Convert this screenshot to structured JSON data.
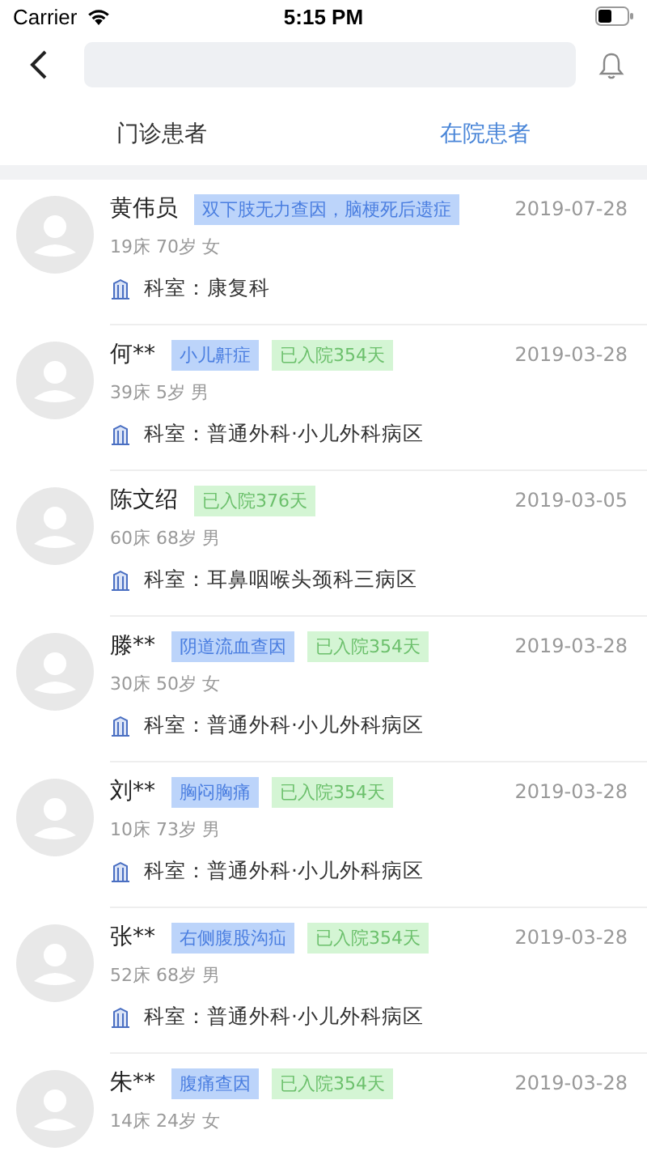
{
  "status_bar": {
    "carrier": "Carrier",
    "time": "5:15 PM"
  },
  "tabs": [
    {
      "label": "门诊患者",
      "selected": false
    },
    {
      "label": "在院患者",
      "selected": true
    }
  ],
  "patients": [
    {
      "name": "黄伟员",
      "diagnosis": "双下肢无力查因，脑梗死后遗症",
      "date": "2019-07-28",
      "info": "19床 70岁 女",
      "department": "科室：康复科"
    },
    {
      "name": "何**",
      "diagnosis": "小儿鼾症",
      "stay": "已入院354天",
      "date": "2019-03-28",
      "info": "39床 5岁 男",
      "department": "科室：普通外科·小儿外科病区"
    },
    {
      "name": "陈文绍",
      "stay": "已入院376天",
      "date": "2019-03-05",
      "info": "60床 68岁 男",
      "department": "科室：耳鼻咽喉头颈科三病区"
    },
    {
      "name": "滕**",
      "diagnosis": "阴道流血查因",
      "stay": "已入院354天",
      "date": "2019-03-28",
      "info": "30床 50岁 女",
      "department": "科室：普通外科·小儿外科病区"
    },
    {
      "name": "刘**",
      "diagnosis": "胸闷胸痛",
      "stay": "已入院354天",
      "date": "2019-03-28",
      "info": "10床 73岁 男",
      "department": "科室：普通外科·小儿外科病区"
    },
    {
      "name": "张**",
      "diagnosis": "右侧腹股沟疝",
      "stay": "已入院354天",
      "date": "2019-03-28",
      "info": "52床 68岁 男",
      "department": "科室：普通外科·小儿外科病区"
    },
    {
      "name": "朱**",
      "diagnosis": "腹痛查因",
      "stay": "已入院354天",
      "date": "2019-03-28",
      "info": "14床 24岁 女"
    }
  ]
}
